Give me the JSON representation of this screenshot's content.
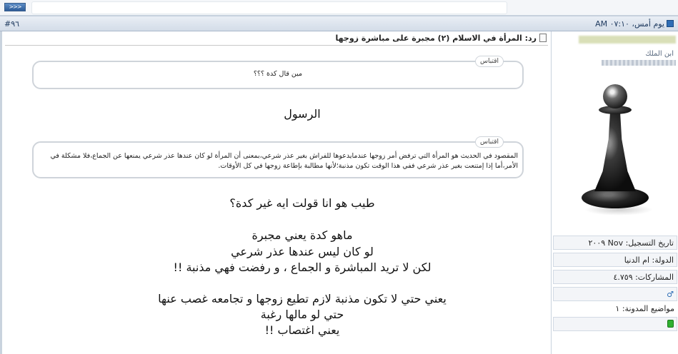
{
  "topbar": {
    "go_button_label": ">>>"
  },
  "post": {
    "number": "#٩٦",
    "date": "يوم أمس، ٠٧:١٠ AM",
    "title": "رد: المرأة في الاسلام (٢) مجبرة على مباشرة زوجها",
    "quote1": {
      "label": "اقتباس",
      "text": "مين قال كدة ؟؟؟"
    },
    "line_rasool": "الرسول",
    "quote2": {
      "label": "اقتباس",
      "text": "المقصود في الحديث هو المرأة التي ترفض أمر زوجها عندمايدعوها للفراش بغير عذر شرعي،بمعنى أن المرأة لو كان عندها عذر شرعي يمنعها عن الجماع،فلا مشكلة في الأمر،أما إذا إمتنعت بغير عذر شرعي ففي هذا الوقت تكون مذنبة؛لأنها مطالبة بإطاعة زوجها في كل الأوقات."
    },
    "body_lines": [
      "طيب هو انا قولت ايه غير كدة؟",
      "ماهو كدة يعني مجبرة",
      "لو كان ليس عندها عذر شرعي",
      "لكن لا تريد المباشرة و الجماع ، و رفضت فهي مذنبة !!",
      "يعني حتي لا تكون مذنبة لازم تطيع زوجها و تجامعه غصب عنها",
      "حتي لو مالها رغبة",
      "يعني اغتصاب !!"
    ]
  },
  "user": {
    "title_prefix": "ابن الملك",
    "registration": "تاريخ التسجيل: Nov ٢٠٠٩",
    "country": "الدولة: ام الدنيا",
    "posts": "المشاركات: ٤.٧٥٩",
    "gender_icon": "♂",
    "blog_topics": "مواضيع المدونة: ١",
    "status_color": "#30b030"
  }
}
